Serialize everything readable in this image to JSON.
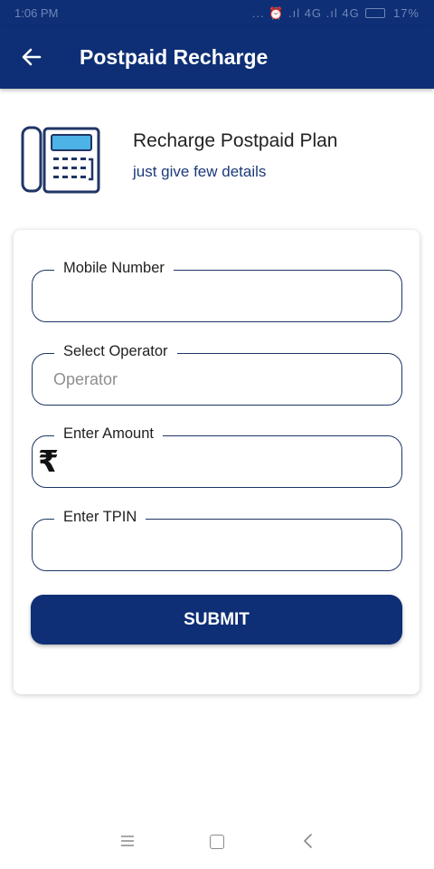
{
  "status_bar": {
    "time": "1:06 PM",
    "right_indicators": "... ⏰ .ıl 4G .ıl 4G",
    "battery": "17%"
  },
  "app_bar": {
    "title": "Postpaid Recharge",
    "back_icon": "arrow-left-icon"
  },
  "hero": {
    "icon": "telephone-icon",
    "title": "Recharge Postpaid Plan",
    "subtitle": "just give few details"
  },
  "form": {
    "mobile": {
      "label": "Mobile Number",
      "value": ""
    },
    "operator": {
      "label": "Select Operator",
      "placeholder": "Operator"
    },
    "amount": {
      "label": "Enter Amount",
      "currency_symbol": "₹",
      "value": ""
    },
    "tpin": {
      "label": "Enter TPIN",
      "value": ""
    },
    "submit_label": "SUBMIT"
  },
  "colors": {
    "primary": "#0e2f75",
    "border": "#1f3566",
    "placeholder": "#8f8f8f"
  },
  "navbar": {
    "icons": [
      "menu-icon",
      "home-square-icon",
      "back-chevron-icon"
    ]
  }
}
